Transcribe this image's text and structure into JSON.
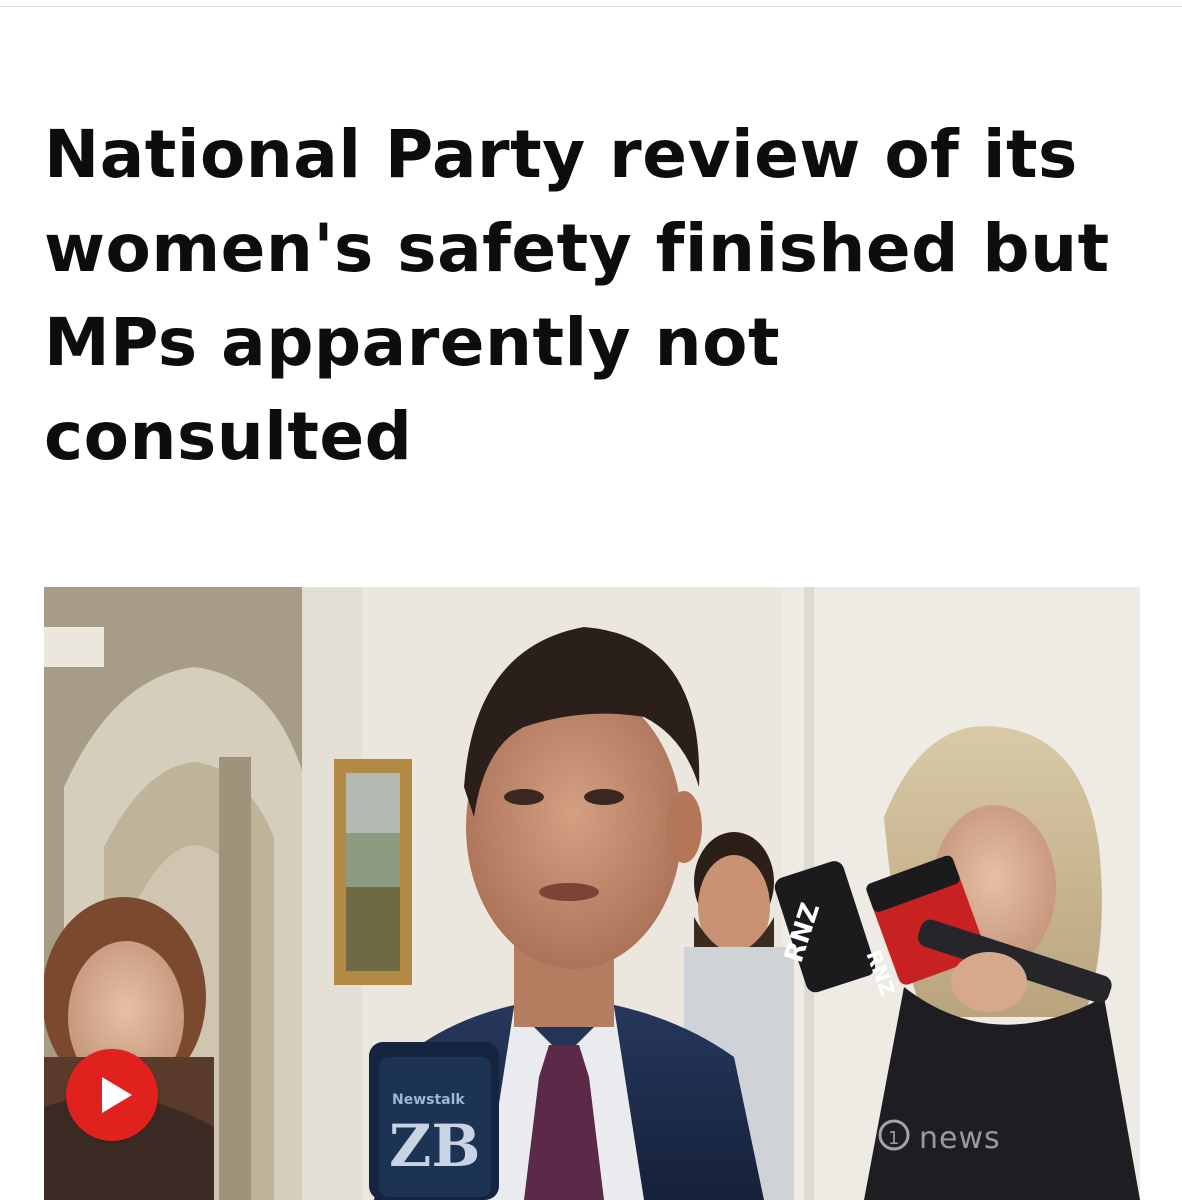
{
  "article": {
    "headline_lines": [
      "National Party review of its",
      "women's safety finished but",
      "MPs apparently not",
      "consulted"
    ]
  },
  "video": {
    "play_icon": "play-icon",
    "mic_labels": {
      "rnz_left": "RNZ",
      "rnz_right": "RNZ",
      "newstalk_small": "Newstalk",
      "newstalk_big": "ZB"
    },
    "watermark": "news",
    "watermark_num": "1"
  },
  "colors": {
    "play_button": "#e0211d",
    "headline_text": "#0d0d0d",
    "background": "#ffffff"
  }
}
